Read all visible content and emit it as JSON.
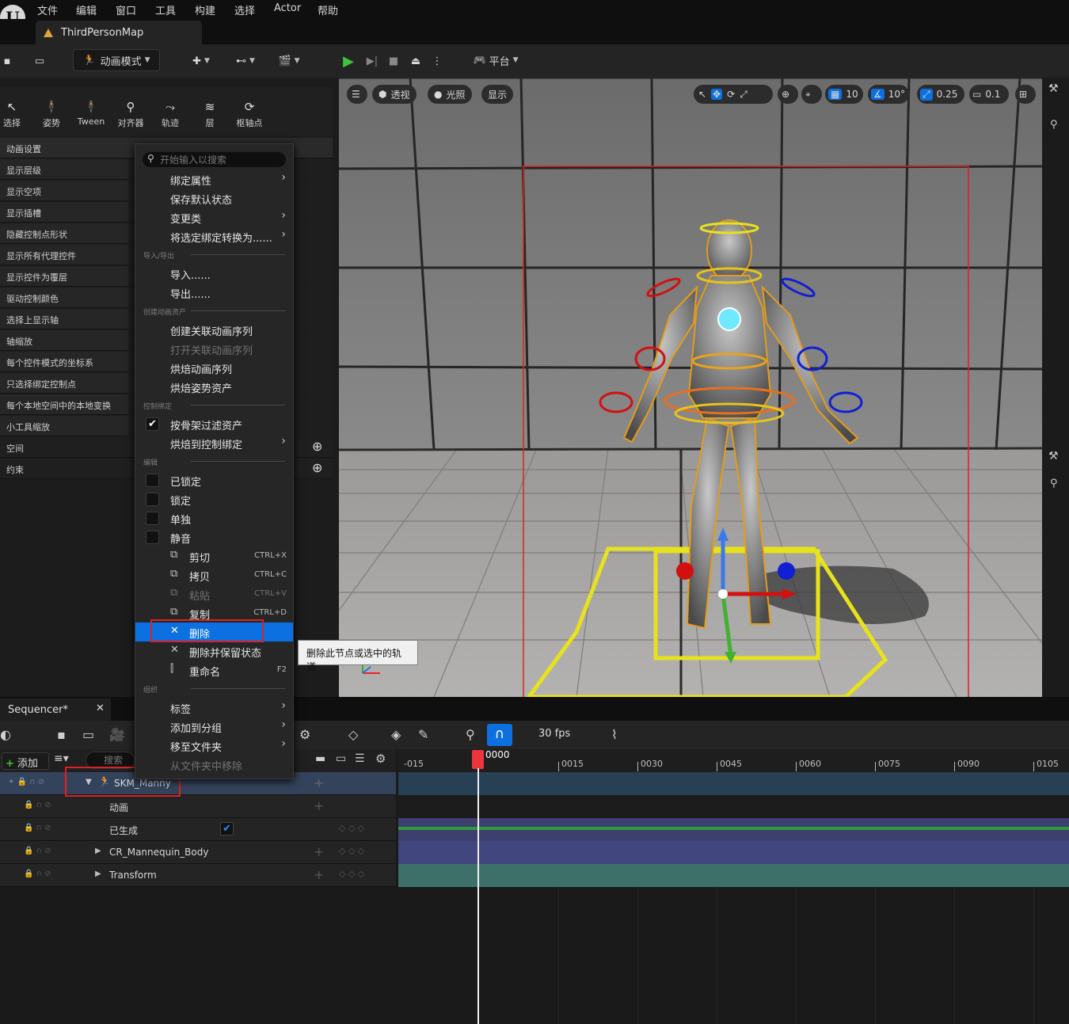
{
  "menubar": {
    "items": [
      "文件",
      "编辑",
      "窗口",
      "工具",
      "构建",
      "选择",
      "Actor",
      "帮助"
    ]
  },
  "map_tab": {
    "title": "ThirdPersonMap"
  },
  "toolbar": {
    "mode_label": "动画模式",
    "platform_label": "平台"
  },
  "mode_tools": [
    "选择",
    "姿势",
    "Tween",
    "对齐器",
    "轨迹",
    "层",
    "枢轴点"
  ],
  "settings_rows": [
    "动画设置",
    "显示层级",
    "显示空项",
    "显示插槽",
    "隐藏控制点形状",
    "显示所有代理控件",
    "显示控件为覆层",
    "驱动控制颜色",
    "选择上显示轴",
    "轴缩放",
    "每个控件模式的坐标系",
    "只选择绑定控制点",
    "每个本地空间中的本地变换",
    "小工具缩放",
    "空间",
    "约束"
  ],
  "context_menu": {
    "search_placeholder": "开始输入以搜索",
    "group1": [
      "绑定属性",
      "保存默认状态",
      "变更类",
      "将选定绑定转换为......"
    ],
    "sec_import": "导入/导出",
    "import": "导入......",
    "export": "导出......",
    "sec_create": "创建动画资产",
    "create": [
      "创建关联动画序列",
      "打开关联动画序列",
      "烘焙动画序列",
      "烘焙姿势资产"
    ],
    "sec_control": "控制绑定",
    "filter_by_skeleton": "按骨架过滤资产",
    "bake_control": "烘焙到控制绑定",
    "sec_edit": "编辑",
    "toggles": [
      "已锁定",
      "锁定",
      "单独",
      "静音"
    ],
    "cut": "剪切",
    "cut_sc": "CTRL+X",
    "copy": "拷贝",
    "copy_sc": "CTRL+C",
    "paste": "粘贴",
    "paste_sc": "CTRL+V",
    "duplicate": "复制",
    "duplicate_sc": "CTRL+D",
    "delete": "删除",
    "delete_keep": "删除并保留状态",
    "rename": "重命名",
    "rename_sc": "F2",
    "sec_org": "组织",
    "org": [
      "标签",
      "添加到分组",
      "移至文件夹",
      "从文件夹中移除"
    ]
  },
  "tooltip": "删除此节点或选中的轨道",
  "viewport": {
    "perspective": "透视",
    "lighting": "光照",
    "show": "显示",
    "grid_snap": "10",
    "rot_snap": "10°",
    "scale_snap": "0.25",
    "cam_speed": "0.1"
  },
  "sequencer": {
    "tab": "Sequencer*",
    "add_label": "添加",
    "search_placeholder": "搜索",
    "fps": "30 fps",
    "current_frame": "0000",
    "ticks": [
      "-015",
      "0015",
      "0030",
      "0045",
      "0060",
      "0075",
      "0090",
      "0105"
    ],
    "tracks": [
      "SKM_Manny",
      "动画",
      "已生成",
      "CR_Mannequin_Body",
      "Transform"
    ]
  },
  "colors": {
    "accent": "#0c70e0",
    "highlight_box": "#e02020",
    "playhead": "#e8363c",
    "selection_bounds": "#e02020",
    "gizmo_yellow": "#e8e21c"
  }
}
